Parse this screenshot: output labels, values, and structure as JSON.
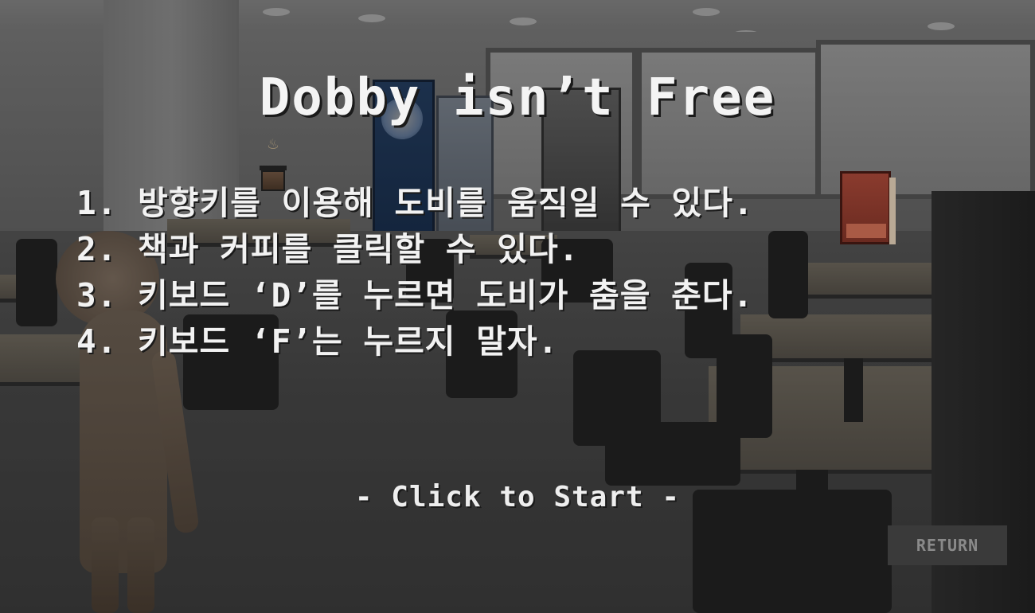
{
  "game": {
    "title": "Dobby isn’t Free",
    "rules": [
      "1. 방향키를 이용해 도비를 움직일 수 있다.",
      "2. 책과 커피를 클릭할 수 있다.",
      "3. 키보드 ‘D’를 누르면 도비가 춤을 춘다.",
      "4. 키보드 ‘F’는 누르지 말자."
    ],
    "start_prompt": "- Click to Start -",
    "return_label": "RETURN"
  },
  "items": {
    "coffee_steam": "♨"
  },
  "colors": {
    "text": "#f2f2f2",
    "overlay": "rgba(0,0,0,0.38)",
    "return_button_bg": "#3a3a3a",
    "return_button_text": "#8a8a8a"
  }
}
